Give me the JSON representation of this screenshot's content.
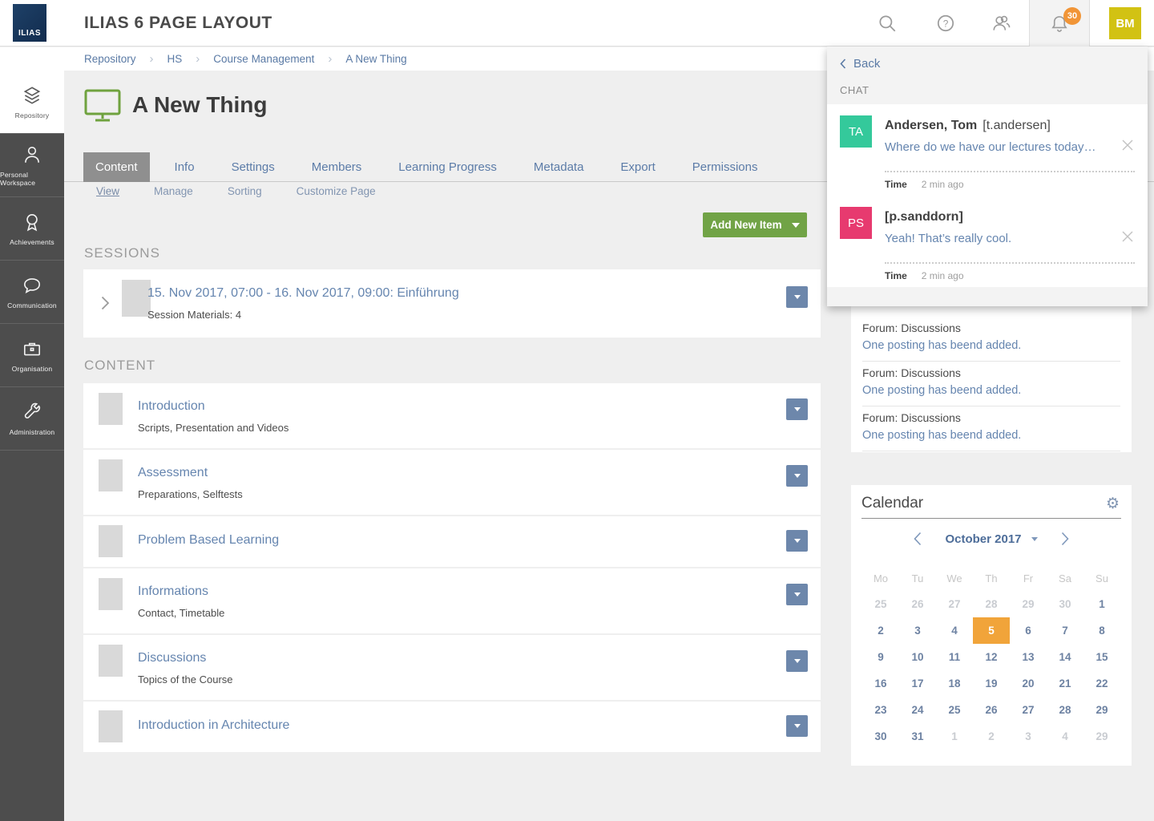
{
  "header": {
    "logo_text": "ILIAS",
    "title": "ILIAS 6 PAGE LAYOUT",
    "notification_count": "30",
    "avatar_initials": "BM"
  },
  "breadcrumb": {
    "items": [
      "Repository",
      "HS",
      "Course Management",
      "A New Thing"
    ],
    "separator": "›"
  },
  "sidebar": {
    "items": [
      {
        "label": "Repository",
        "icon": "layers-icon",
        "active": true
      },
      {
        "label": "Personal Workspace",
        "icon": "person-icon"
      },
      {
        "label": "Achievements",
        "icon": "ribbon-icon"
      },
      {
        "label": "Communication",
        "icon": "speech-bubble-icon"
      },
      {
        "label": "Organisation",
        "icon": "briefcase-icon"
      },
      {
        "label": "Administration",
        "icon": "wrench-icon"
      }
    ]
  },
  "page": {
    "title": "A New Thing",
    "tabs": [
      {
        "label": "Content",
        "active": true
      },
      {
        "label": "Info"
      },
      {
        "label": "Settings"
      },
      {
        "label": "Members"
      },
      {
        "label": "Learning Progress"
      },
      {
        "label": "Metadata"
      },
      {
        "label": "Export"
      },
      {
        "label": "Permissions"
      }
    ],
    "subtabs": [
      {
        "label": "View",
        "active": true
      },
      {
        "label": "Manage"
      },
      {
        "label": "Sorting"
      },
      {
        "label": "Customize Page"
      }
    ],
    "add_button_label": "Add New Item",
    "sessions_heading": "SESSIONS",
    "session": {
      "title": "15. Nov 2017, 07:00 - 16. Nov 2017, 09:00: Einführung",
      "subtitle": "Session Materials: 4"
    },
    "content_heading": "CONTENT",
    "content_items": [
      {
        "title": "Introduction",
        "subtitle": "Scripts, Presentation and Videos"
      },
      {
        "title": "Assessment",
        "subtitle": "Preparations, Selftests"
      },
      {
        "title": "Problem Based Learning",
        "subtitle": "",
        "short": true
      },
      {
        "title": "Informations",
        "subtitle": "Contact, Timetable"
      },
      {
        "title": "Discussions",
        "subtitle": "Topics of the Course"
      },
      {
        "title": "Introduction in Architecture",
        "subtitle": "",
        "short": true
      }
    ]
  },
  "chat_panel": {
    "back_label": "Back",
    "section_label": "CHAT",
    "items": [
      {
        "initials": "TA",
        "color": "#34c99b",
        "name": "Andersen, Tom",
        "handle": "[t.andersen]",
        "message": "Where do we have our lectures today…",
        "time_label": "Time",
        "time_value": "2 min ago"
      },
      {
        "initials": "PS",
        "color": "#e73a6f",
        "name": "[p.sanddorn]",
        "handle": "",
        "message": "Yeah! That’s really cool.",
        "time_label": "Time",
        "time_value": "2 min ago"
      }
    ]
  },
  "notifications_panel": {
    "items": [
      {
        "title": "Forum: Discussions",
        "link": "One posting has beend added."
      },
      {
        "title": "Forum: Discussions",
        "link": "One posting has beend added."
      },
      {
        "title": "Forum: Discussions",
        "link": "One posting has beend added."
      }
    ]
  },
  "calendar": {
    "title": "Calendar",
    "gear_glyph": "⚙",
    "month_label": "October 2017",
    "weekdays": [
      "Mo",
      "Tu",
      "We",
      "Th",
      "Fr",
      "Sa",
      "Su"
    ],
    "highlight_color": "#f1a43a",
    "days": [
      {
        "d": "25",
        "muted": true
      },
      {
        "d": "26",
        "muted": true
      },
      {
        "d": "27",
        "muted": true
      },
      {
        "d": "28",
        "muted": true
      },
      {
        "d": "29",
        "muted": true
      },
      {
        "d": "30",
        "muted": true
      },
      {
        "d": "1"
      },
      {
        "d": "2"
      },
      {
        "d": "3"
      },
      {
        "d": "4"
      },
      {
        "d": "5",
        "highlight": true
      },
      {
        "d": "6"
      },
      {
        "d": "7"
      },
      {
        "d": "8"
      },
      {
        "d": "9"
      },
      {
        "d": "10"
      },
      {
        "d": "11"
      },
      {
        "d": "12"
      },
      {
        "d": "13"
      },
      {
        "d": "14"
      },
      {
        "d": "15"
      },
      {
        "d": "16"
      },
      {
        "d": "17"
      },
      {
        "d": "18"
      },
      {
        "d": "19"
      },
      {
        "d": "20"
      },
      {
        "d": "21"
      },
      {
        "d": "22"
      },
      {
        "d": "23"
      },
      {
        "d": "24"
      },
      {
        "d": "25"
      },
      {
        "d": "26"
      },
      {
        "d": "27"
      },
      {
        "d": "28"
      },
      {
        "d": "29"
      },
      {
        "d": "30"
      },
      {
        "d": "31"
      },
      {
        "d": "1",
        "muted": true
      },
      {
        "d": "2",
        "muted": true
      },
      {
        "d": "3",
        "muted": true
      },
      {
        "d": "4",
        "muted": true
      },
      {
        "d": "29",
        "muted": true
      }
    ]
  }
}
